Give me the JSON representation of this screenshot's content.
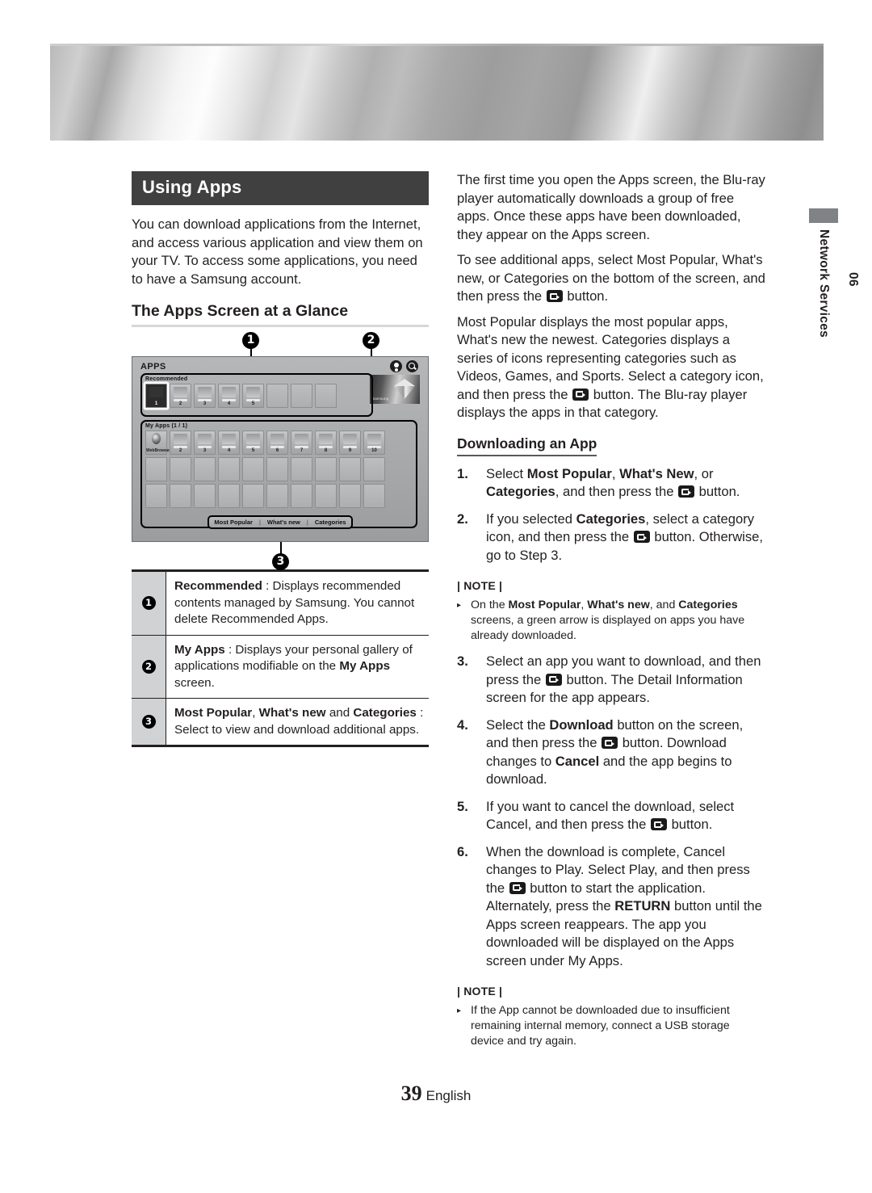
{
  "page": {
    "number": "39",
    "language": "English"
  },
  "side_tab": {
    "chapter_number": "06",
    "chapter_title": "Network Services"
  },
  "left_column": {
    "section_title": "Using Apps",
    "intro_paragraph": "You can download applications from the Internet, and access various application and view them on your TV. To access some applications, you need to have a Samsung account.",
    "subsection_title": "The Apps Screen at a Glance",
    "callouts": [
      "1",
      "2",
      "3"
    ],
    "figure": {
      "screen_title": "APPS",
      "recommended_label": "Recommended",
      "my_apps_label": "My Apps (1 / 1)",
      "recommended_tiles": [
        "1",
        "2",
        "3",
        "4",
        "5"
      ],
      "recommended_empty_count": 3,
      "my_apps_first_label": "WebBrowser",
      "my_apps_tiles": [
        "2",
        "3",
        "4",
        "5",
        "6",
        "7",
        "8",
        "9",
        "10"
      ],
      "bottom_menu": [
        "Most Popular",
        "What's new",
        "Categories"
      ],
      "menu_separator": "|",
      "promo_text": "Samsung",
      "icons": [
        "person-icon",
        "search-icon"
      ]
    },
    "legend_rows": [
      {
        "badge": "1",
        "term": "Recommended",
        "separator": " : ",
        "body": "Displays recommended contents managed by Samsung. You cannot delete Recommended Apps."
      },
      {
        "badge": "2",
        "term": "My Apps",
        "separator": " : ",
        "body_1": "Displays your personal gallery of applications modifiable on the ",
        "body_bold": "My Apps",
        "body_2": " screen."
      },
      {
        "badge": "3",
        "term_1": "Most Popular",
        "term_sep_1": ", ",
        "term_2": "What's new",
        "term_sep_2": " and ",
        "term_3": "Categories",
        "separator": " : ",
        "body": "Select to view and download additional apps."
      }
    ]
  },
  "right_column": {
    "paragraphs": [
      "The first time you open the Apps screen, the Blu-ray player automatically downloads  a group of free apps. Once these apps have been downloaded, they appear on the Apps screen.",
      "Most Popular displays the most popular apps, What's new the newest. Categories displays a series of icons representing categories such as Videos, Games, and Sports. Select a category icon, and then press the "
    ],
    "para2_part1": "To see additional apps, select Most Popular, What's new, or Categories on the bottom of the screen, and then press the ",
    "para2_part2": " button.",
    "para3_part1": "Most Popular displays the most popular apps, What's new the newest. Categories displays a series of icons representing categories such as Videos, Games, and Sports. Select a category icon, and then press the ",
    "para3_part2": " button. The Blu-ray player displays the apps in that category.",
    "subsection_title": "Downloading an App",
    "steps": [
      {
        "num": "1.",
        "t1": "Select ",
        "b1": "Most Popular",
        "t2": ", ",
        "b2": "What's New",
        "t3": ", or ",
        "b3": "Categories",
        "t4": ", and then press the ",
        "t5": " button."
      },
      {
        "num": "2.",
        "t1": "If you selected ",
        "b1": "Categories",
        "t2": ", select a category icon, and then press the ",
        "t3": " button. Otherwise, go to Step 3."
      },
      {
        "num": "3.",
        "t1": "Select an app you want to download, and then press the ",
        "t2": " button. The Detail Information screen for the app appears."
      },
      {
        "num": "4.",
        "t1": "Select the ",
        "b1": "Download",
        "t2": " button on the screen, and then press the ",
        "t3": " button. Download changes to ",
        "b2": "Cancel",
        "t4": " and the app begins to download."
      },
      {
        "num": "5.",
        "t1": "If you want to cancel the download, select Cancel, and then press the ",
        "t2": " button."
      },
      {
        "num": "6.",
        "t1": "When the download is complete, Cancel changes to Play. Select Play, and then press the ",
        "t2": " button to start the application. Alternately, press the ",
        "b1": "RETURN",
        "t3": " button until the Apps screen reappears. The app you downloaded will be displayed on the Apps screen under My Apps."
      }
    ],
    "note_1": {
      "label": "| NOTE |",
      "arrow": "▸",
      "t1": "On the ",
      "b1": "Most Popular",
      "t2": ", ",
      "b2": "What's new",
      "t3": ", and ",
      "b3": "Categories",
      "t4": " screens, a green arrow is displayed on apps you have already downloaded."
    },
    "note_2": {
      "label": "| NOTE |",
      "arrow": "▸",
      "text": "If the App cannot be downloaded due to insufficient remaining internal memory, connect a USB storage device and try again."
    }
  },
  "colors": {
    "section_bar_bg": "#404041",
    "legend_num_bg": "#d0d2d3",
    "side_tab_swatch": "#808285",
    "text": "#231f20"
  }
}
